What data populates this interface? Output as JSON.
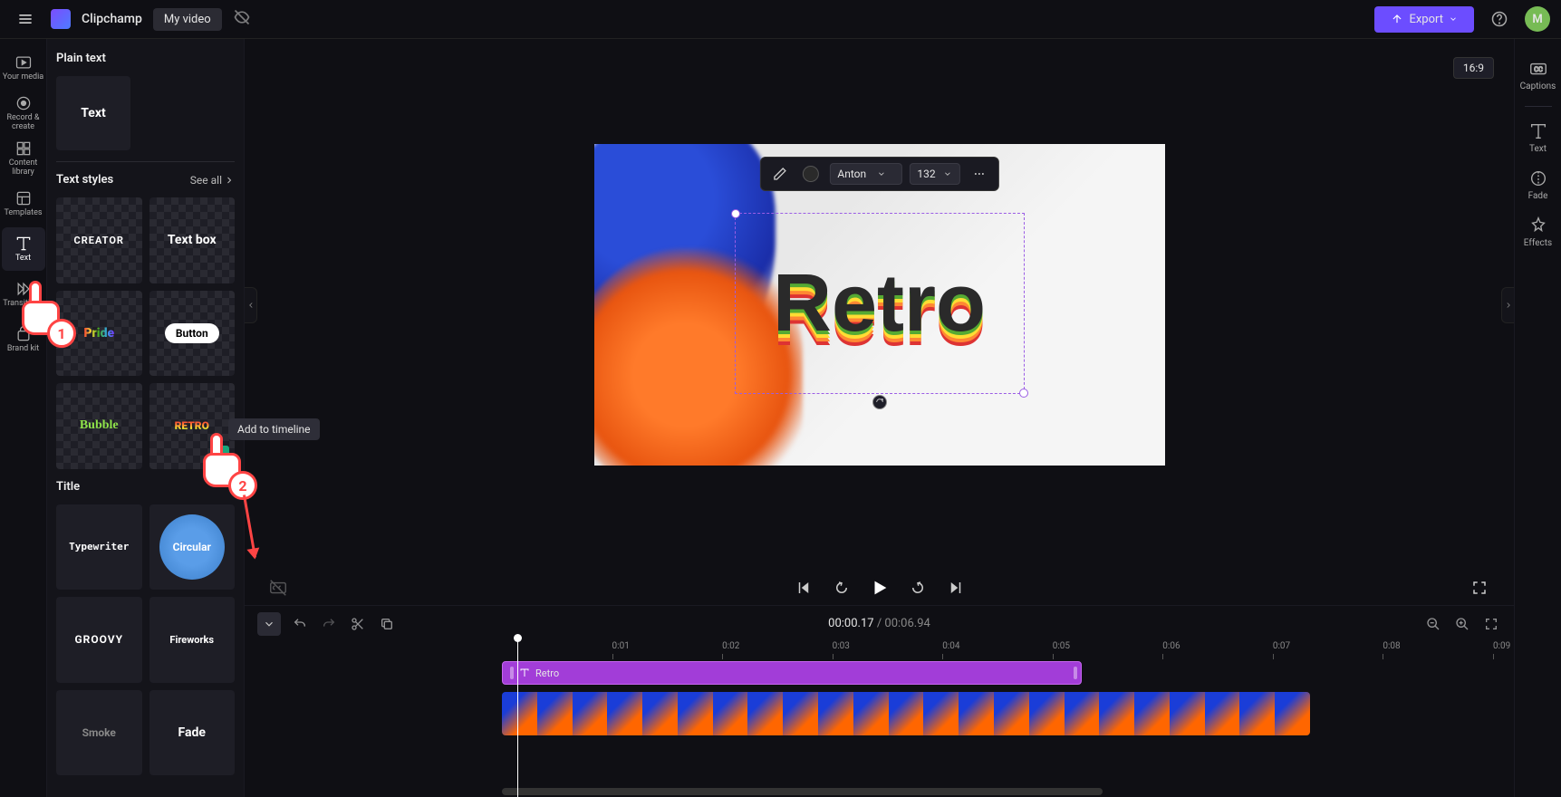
{
  "app": {
    "name": "Clipchamp",
    "project": "My video"
  },
  "topbar": {
    "export": "Export",
    "avatar_initial": "M"
  },
  "left_rail": [
    {
      "label": "Your media"
    },
    {
      "label": "Record & create"
    },
    {
      "label": "Content library"
    },
    {
      "label": "Templates"
    },
    {
      "label": "Text"
    },
    {
      "label": "Transitions"
    },
    {
      "label": "Brand kit"
    }
  ],
  "panel": {
    "plain_text_heading": "Plain text",
    "plain_text_thumb": "Text",
    "styles_heading": "Text styles",
    "see_all": "See all",
    "styles": {
      "creator": "CREATOR",
      "textbox": "Text box",
      "pride": "Pride",
      "button": "Button",
      "bubble": "Bubble",
      "retro": "RETRO"
    },
    "title_heading": "Title",
    "titles": {
      "typewriter": "Typewriter",
      "circular": "Circular",
      "groovy": "GROOVY",
      "fireworks": "Fireworks",
      "smoke": "Smoke",
      "fade": "Fade"
    }
  },
  "canvas": {
    "aspect": "16:9",
    "text_value": "Retro",
    "toolbar": {
      "font": "Anton",
      "size": "132"
    }
  },
  "playback": {
    "current": "00:00.17",
    "total": "00:06.94"
  },
  "ruler": [
    "0:01",
    "0:02",
    "0:03",
    "0:04",
    "0:05",
    "0:06",
    "0:07",
    "0:08",
    "0:09"
  ],
  "timeline": {
    "text_clip_label": "Retro"
  },
  "right_rail": {
    "captions": "Captions",
    "text": "Text",
    "fade": "Fade",
    "effects": "Effects"
  },
  "tooltip": {
    "add_timeline": "Add to timeline"
  },
  "annotations": {
    "step1": "1",
    "step2": "2"
  }
}
